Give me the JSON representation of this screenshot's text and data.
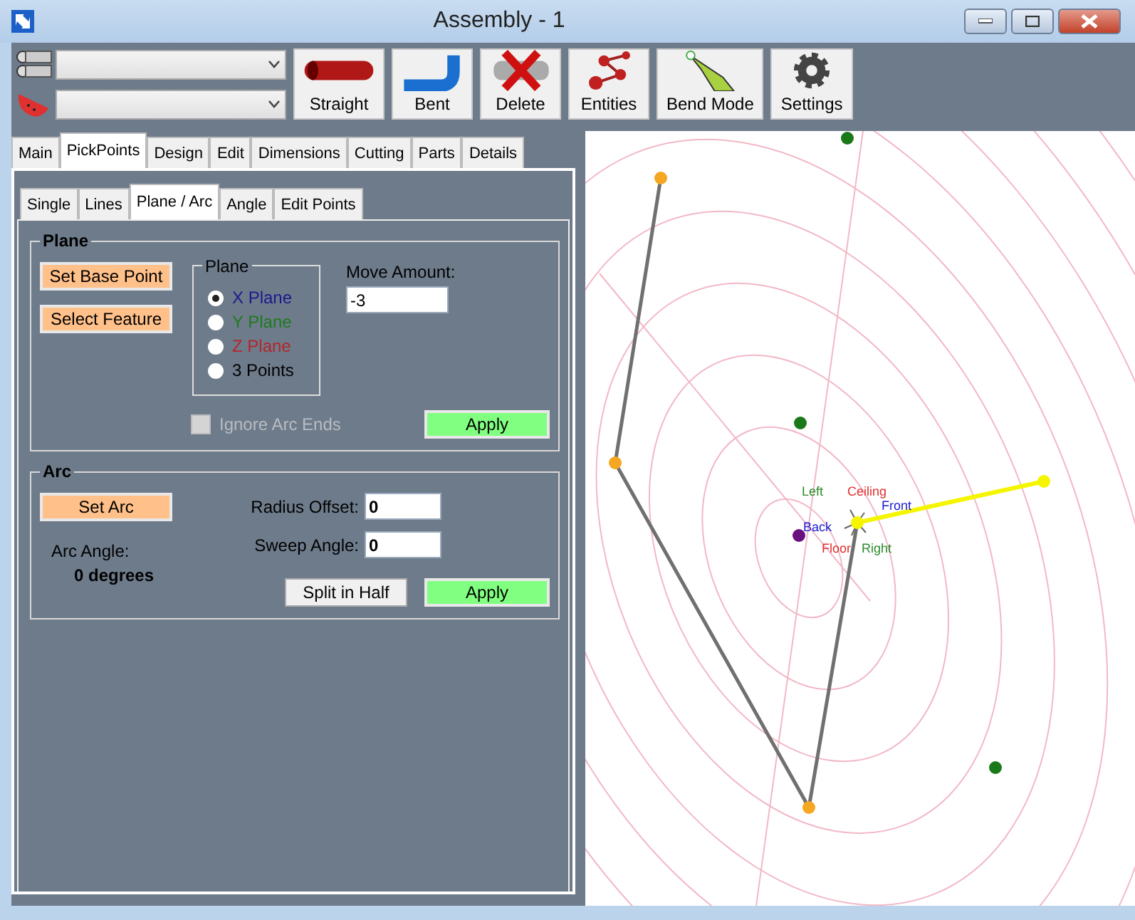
{
  "window": {
    "title": "Assembly - 1"
  },
  "toolbar": {
    "buttons": [
      {
        "label": "Straight",
        "kind": "straight"
      },
      {
        "label": "Bent",
        "kind": "bent"
      },
      {
        "label": "Delete",
        "kind": "delete"
      },
      {
        "label": "Entities",
        "kind": "entities"
      },
      {
        "label": "Bend Mode",
        "kind": "bend"
      },
      {
        "label": "Settings",
        "kind": "settings"
      }
    ]
  },
  "tabs": [
    {
      "label": "Main",
      "selected": false
    },
    {
      "label": "PickPoints",
      "selected": true
    },
    {
      "label": "Design",
      "selected": false
    },
    {
      "label": "Edit",
      "selected": false
    },
    {
      "label": "Dimensions",
      "selected": false
    },
    {
      "label": "Cutting",
      "selected": false
    },
    {
      "label": "Parts",
      "selected": false
    },
    {
      "label": "Details",
      "selected": false
    }
  ],
  "subtabs": [
    {
      "label": "Single",
      "selected": false
    },
    {
      "label": "Lines",
      "selected": false
    },
    {
      "label": "Plane / Arc",
      "selected": true
    },
    {
      "label": "Angle",
      "selected": false
    },
    {
      "label": "Edit Points",
      "selected": false
    }
  ],
  "plane_group": {
    "title": "Plane",
    "buttons": [
      "Set Base Point",
      "Select Feature"
    ],
    "plane_box": {
      "title": "Plane",
      "options": [
        {
          "label": "X Plane",
          "selected": true,
          "color": "#1a1a8c"
        },
        {
          "label": "Y Plane",
          "selected": false,
          "color": "#1f7a1f"
        },
        {
          "label": "Z Plane",
          "selected": false,
          "color": "#b3262a"
        },
        {
          "label": "3 Points",
          "selected": false,
          "color": "#000000"
        }
      ]
    },
    "move_amount": {
      "label": "Move Amount:",
      "value": "-3"
    },
    "ignore_arc_ends": {
      "label": "Ignore Arc Ends",
      "checked": false,
      "disabled": true
    },
    "apply": "Apply"
  },
  "arc_group": {
    "title": "Arc",
    "set_arc": "Set Arc",
    "radius_offset": {
      "label": "Radius Offset:",
      "value": "0"
    },
    "sweep_angle": {
      "label": "Sweep Angle:",
      "value": "0"
    },
    "arc_angle_label": "Arc Angle:",
    "arc_angle_value": "0 degrees",
    "split": "Split in Half",
    "apply": "Apply"
  },
  "viewport": {
    "axis_labels": [
      {
        "label": "Left",
        "kind": "left"
      },
      {
        "label": "Ceiling",
        "kind": "ceiling"
      },
      {
        "label": "Front",
        "kind": "front"
      },
      {
        "label": "Back",
        "kind": "back"
      },
      {
        "label": "Floor",
        "kind": "floor"
      },
      {
        "label": "Right",
        "kind": "right"
      }
    ]
  }
}
